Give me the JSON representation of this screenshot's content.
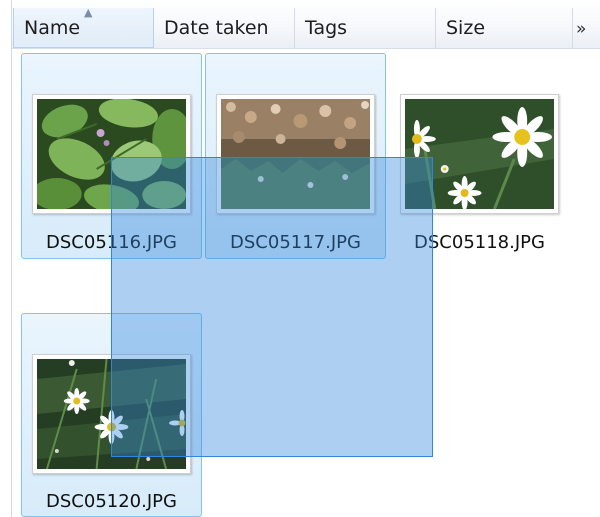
{
  "columns": {
    "name": "Name",
    "date_taken": "Date taken",
    "tags": "Tags",
    "size": "Size",
    "more": "»"
  },
  "sort": {
    "column": "Name",
    "direction": "ascending",
    "icon": "sort-up-arrow"
  },
  "files": [
    {
      "name": "DSC05116.JPG",
      "selected": true,
      "image": "hosta leaves"
    },
    {
      "name": "DSC05117.JPG",
      "selected": true,
      "image": "shrub with small blossoms"
    },
    {
      "name": "DSC05118.JPG",
      "selected": false,
      "image": "white daisies"
    },
    {
      "name": "DSC05120.JPG",
      "selected": true,
      "image": "daisies among foliage"
    }
  ],
  "colors": {
    "selection_border": "#84c3ee",
    "selection_fill": "#d7ebfa",
    "rubber_band": "#3384dd"
  }
}
